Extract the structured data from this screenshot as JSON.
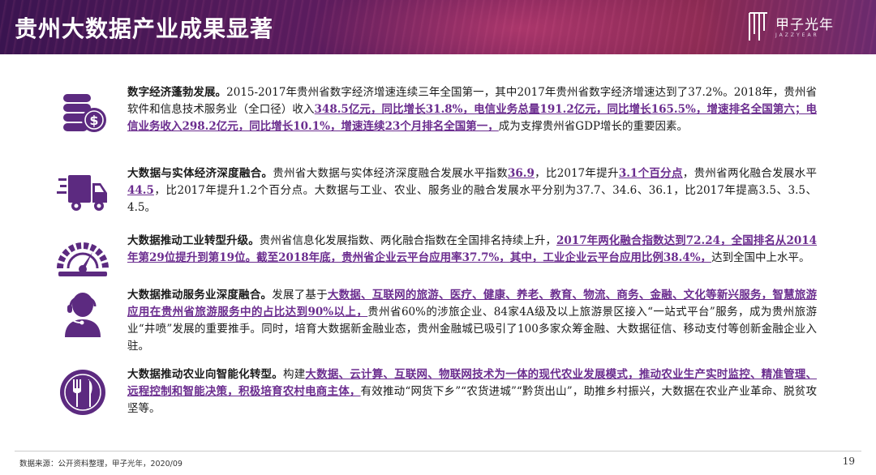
{
  "header": {
    "title": "贵州大数据产业成果显著",
    "logo_text": "甲子光年",
    "logo_sub": "JAZZYEAR"
  },
  "sections": [
    {
      "icon": "coins-dollar-icon",
      "lead": "数字经济蓬勃发展。",
      "parts": [
        {
          "t": "2015-2017年贵州省数字经济增速连续三年全国第一，其中2017年贵州省数字经济增速达到了37.2%。2018年，贵州省软件和信息技术服务业（全口径）收入",
          "h": false
        },
        {
          "t": "348.5亿元，同比增长31.8%，电信业务总量191.2亿元，同比增长165.5%，增速排名全国第六；电信业务收入298.2亿元，同比增长10.1%，增速连续23个月排名全国第一，",
          "h": true
        },
        {
          "t": "成为支撑贵州省GDP增长的重要因素。",
          "h": false
        }
      ]
    },
    {
      "icon": "delivery-truck-icon",
      "lead": "大数据与实体经济深度融合。",
      "parts": [
        {
          "t": "贵州省大数据与实体经济深度融合发展水平指数",
          "h": false
        },
        {
          "t": "36.9",
          "h": true
        },
        {
          "t": "，比2017年提升",
          "h": false
        },
        {
          "t": "3.1个百分点",
          "h": true
        },
        {
          "t": "，贵州省两化融合发展水平",
          "h": false
        },
        {
          "t": "44.5",
          "h": true
        },
        {
          "t": "，比2017年提升1.2个百分点。大数据与工业、农业、服务业的融合发展水平分别为37.7、34.6、36.1，比2017年提高3.5、3.5、4.5。",
          "h": false
        }
      ]
    },
    {
      "icon": "speedometer-icon",
      "lead": "大数据推动工业转型升级。",
      "parts": [
        {
          "t": "贵州省信息化发展指数、两化融合指数在全国排名持续上升，",
          "h": false
        },
        {
          "t": "2017年两化融合指数达到72.24，全国排名从2014年第29位提升到第19位。截至2018年底，贵州省企业云平台应用率37.7%，其中，工业企业云平台应用比例38.4%，",
          "h": true
        },
        {
          "t": "达到全国中上水平。",
          "h": false
        }
      ]
    },
    {
      "icon": "customer-service-icon",
      "lead": "大数据推动服务业深度融合。",
      "parts": [
        {
          "t": "发展了基于",
          "h": false
        },
        {
          "t": "大数据、互联网的旅游、医疗、健康、养老、教育、物流、商务、金融、文化等新兴服务，智慧旅游应用在贵州省旅游服务中的占比达到90%以上，",
          "h": true
        },
        {
          "t": "贵州省60%的涉旅企业、84家4A级及以上旅游景区接入“一站式平台”服务，成为贵州旅游业“井喷”发展的重要推手。同时，培育大数据新金融业态，贵州金融城已吸引了100多家众筹金融、大数据征信、移动支付等创新金融企业入驻。",
          "h": false
        }
      ]
    },
    {
      "icon": "fork-knife-icon",
      "lead": "大数据推动农业向智能化转型。",
      "parts": [
        {
          "t": "构建",
          "h": false
        },
        {
          "t": "大数据、云计算、互联网、物联网技术为一体的现代农业发展模式，推动农业生产实时监控、精准管理、远程控制和智能决策，积极培育农村电商主体，",
          "h": true
        },
        {
          "t": "有效推动“网货下乡”“农货进城”“黔货出山”，助推乡村振兴，大数据在农业产业革命、脱贫攻坚等。",
          "h": false
        }
      ]
    }
  ],
  "footer": {
    "source": "数据来源：公开资料整理，甲子光年，2020/09",
    "page": "19"
  },
  "colors": {
    "accent": "#6b2d8f",
    "header_start": "#3a1450",
    "header_end": "#8a2a52"
  }
}
